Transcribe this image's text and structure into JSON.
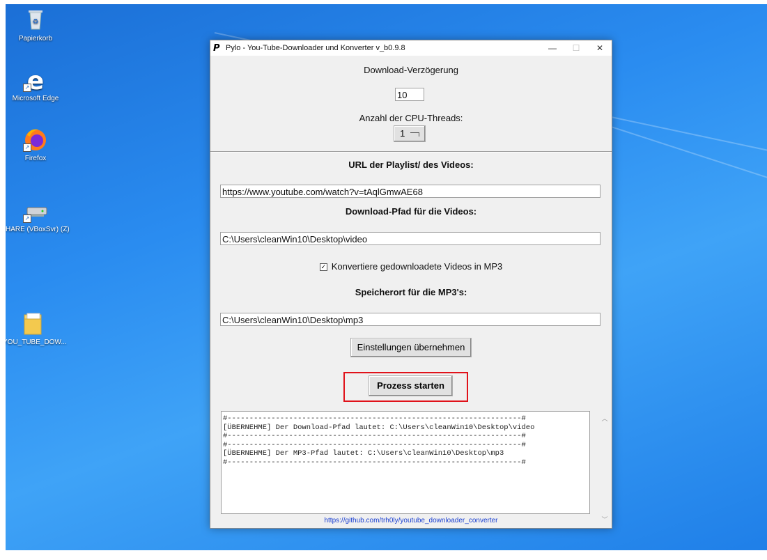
{
  "desktop": {
    "icons": [
      {
        "label": "Papierkorb",
        "icon": "recycle-bin-icon"
      },
      {
        "label": "Microsoft Edge",
        "icon": "edge-icon"
      },
      {
        "label": "Firefox",
        "icon": "firefox-icon"
      },
      {
        "label": "HARE (VBoxSvr) (Z)",
        "icon": "network-drive-icon"
      },
      {
        "label": "YOU_TUBE_DOW...",
        "icon": "folder-icon"
      }
    ]
  },
  "window": {
    "title": "Pylo - You-Tube-Downloader und Konverter v_b0.9.8",
    "controls": {
      "minimize": "—",
      "maximize": "☐",
      "close": "✕"
    },
    "download_delay_label": "Download-Verzögerung",
    "download_delay_value": "10",
    "cpu_threads_label": "Anzahl der CPU-Threads:",
    "cpu_threads_value": "1",
    "url_label": "URL der Playlist/ des Videos:",
    "url_value": "https://www.youtube.com/watch?v=tAqlGmwAE68",
    "download_path_label": "Download-Pfad für die Videos:",
    "download_path_value": "C:\\Users\\cleanWin10\\Desktop\\video",
    "convert_checkbox_label": "Konvertiere gedownloadete Videos in MP3",
    "convert_checked": true,
    "mp3_path_label": "Speicherort für die MP3's:",
    "mp3_path_value": "C:\\Users\\cleanWin10\\Desktop\\mp3",
    "apply_button": "Einstellungen übernehmen",
    "start_button": "Prozess starten",
    "log_lines": [
      "#-------------------------------------------------------------------#",
      "[ÜBERNEHME] Der Download-Pfad lautet: C:\\Users\\cleanWin10\\Desktop\\video",
      "#-------------------------------------------------------------------#",
      "#-------------------------------------------------------------------#",
      "[ÜBERNEHME] Der MP3-Pfad lautet: C:\\Users\\cleanWin10\\Desktop\\mp3",
      "#-------------------------------------------------------------------#"
    ],
    "footer_link": "https://github.com/trh0ly/youtube_downloader_converter"
  },
  "colors": {
    "highlight": "#e0121a",
    "desktop": "#2a8cf0",
    "link": "#1a3fd0"
  }
}
